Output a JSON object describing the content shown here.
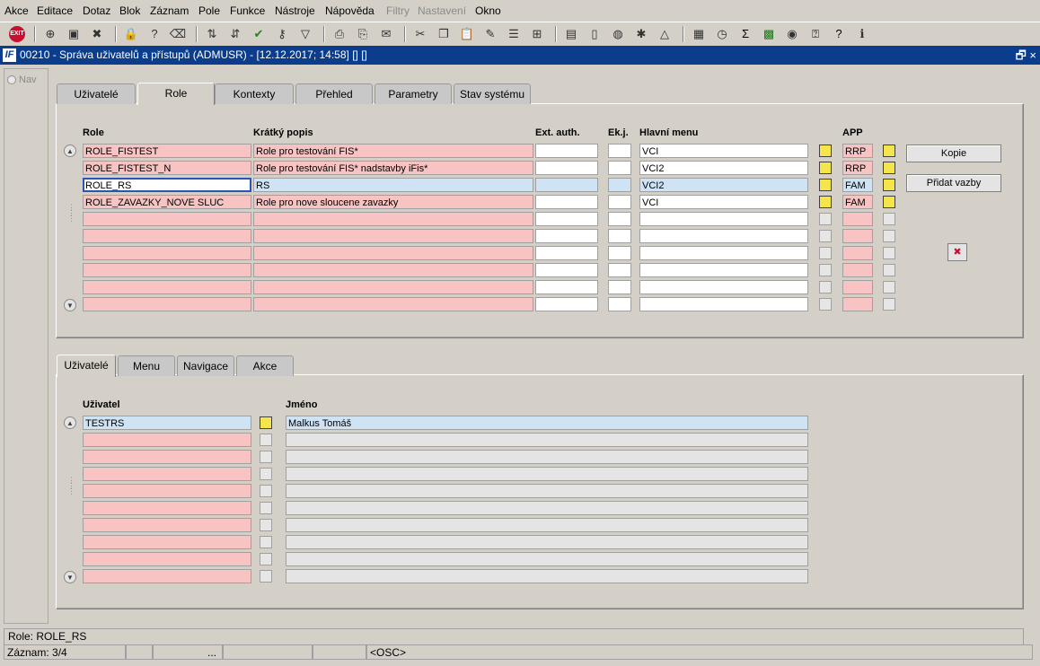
{
  "menu": [
    "Akce",
    "Editace",
    "Dotaz",
    "Blok",
    "Záznam",
    "Pole",
    "Funkce",
    "Nástroje",
    "Nápověda",
    "Filtry",
    "Nastavení",
    "Okno"
  ],
  "menu_disabled": [
    "Filtry",
    "Nastavení"
  ],
  "toolbar_icons": [
    "exit-icon",
    "insert-record-icon",
    "save-icon",
    "delete-record-icon",
    "lock-icon",
    "query-icon",
    "clear-icon",
    "sort-asc-icon",
    "sort-desc-icon",
    "commit-check-icon",
    "key-icon",
    "filter-icon",
    "print-icon",
    "print-preview-icon",
    "mail-icon",
    "cut-icon",
    "copy-icon",
    "paste-icon",
    "edit-icon",
    "list-icon",
    "tree-icon",
    "clipboard-icon",
    "document-icon",
    "globe-icon",
    "tools-icon",
    "network-icon",
    "chart-icon",
    "clock-icon",
    "sigma-icon",
    "excel-icon",
    "explorer-icon",
    "help-context-icon",
    "help-icon",
    "info-icon"
  ],
  "toolbar_exit_label": "EXIT",
  "window": {
    "title": "00210 - Správa uživatelů a přístupů (ADMUSR) - [12.12.2017; 14:58]  [] []",
    "icon_label": "IF",
    "restore_glyph": "🗗",
    "close_glyph": "×"
  },
  "nav": {
    "label": "Nav"
  },
  "top_tabs": [
    "Uživatelé",
    "Role",
    "Kontexty",
    "Přehled",
    "Parametry",
    "Stav systému"
  ],
  "top_active_tab": "Role",
  "roles_table": {
    "headers": {
      "role": "Role",
      "popis": "Krátký popis",
      "ext": "Ext. auth.",
      "ekj": "Ek.j.",
      "menu": "Hlavní menu",
      "app": "APP"
    },
    "rows": [
      {
        "role": "ROLE_FISTEST",
        "popis": "Role pro testování FIS*",
        "ext": "",
        "ekj": "",
        "menu": "VCI",
        "app": "RRP"
      },
      {
        "role": "ROLE_FISTEST_N",
        "popis": "Role pro testování FIS* nadstavby iFis*",
        "ext": "",
        "ekj": "",
        "menu": "VCI2",
        "app": "RRP"
      },
      {
        "role": "ROLE_RS",
        "popis": "RS",
        "ext": "",
        "ekj": "",
        "menu": "VCI2",
        "app": "FAM"
      },
      {
        "role": "ROLE_ZAVAZKY_NOVE SLUC",
        "popis": "Role pro nove sloucene zavazky",
        "ext": "",
        "ekj": "",
        "menu": "VCI",
        "app": "FAM"
      },
      {
        "role": "",
        "popis": "",
        "ext": "",
        "ekj": "",
        "menu": "",
        "app": ""
      },
      {
        "role": "",
        "popis": "",
        "ext": "",
        "ekj": "",
        "menu": "",
        "app": ""
      },
      {
        "role": "",
        "popis": "",
        "ext": "",
        "ekj": "",
        "menu": "",
        "app": ""
      },
      {
        "role": "",
        "popis": "",
        "ext": "",
        "ekj": "",
        "menu": "",
        "app": ""
      },
      {
        "role": "",
        "popis": "",
        "ext": "",
        "ekj": "",
        "menu": "",
        "app": ""
      },
      {
        "role": "",
        "popis": "",
        "ext": "",
        "ekj": "",
        "menu": "",
        "app": ""
      }
    ],
    "selected_row": 2
  },
  "buttons": {
    "kopie": "Kopie",
    "pridat_vazby": "Přidat vazby"
  },
  "bottom_tabs": [
    "Uživatelé",
    "Menu",
    "Navigace",
    "Akce"
  ],
  "bottom_active_tab": "Uživatelé",
  "users_table": {
    "headers": {
      "user": "Uživatel",
      "name": "Jméno"
    },
    "rows": [
      {
        "user": "TESTRS",
        "name": "Malkus Tomáš"
      },
      {
        "user": "",
        "name": ""
      },
      {
        "user": "",
        "name": ""
      },
      {
        "user": "",
        "name": ""
      },
      {
        "user": "",
        "name": ""
      },
      {
        "user": "",
        "name": ""
      },
      {
        "user": "",
        "name": ""
      },
      {
        "user": "",
        "name": ""
      },
      {
        "user": "",
        "name": ""
      },
      {
        "user": "",
        "name": ""
      }
    ]
  },
  "status": {
    "line1": "Role: ROLE_RS",
    "record": "Záznam: 3/4",
    "ellipsis": "...",
    "osc": "<OSC>"
  },
  "colors": {
    "title_bar": "#0b3d8c",
    "required_field": "#f7c3c3",
    "selected_row": "#cfe3f5"
  }
}
